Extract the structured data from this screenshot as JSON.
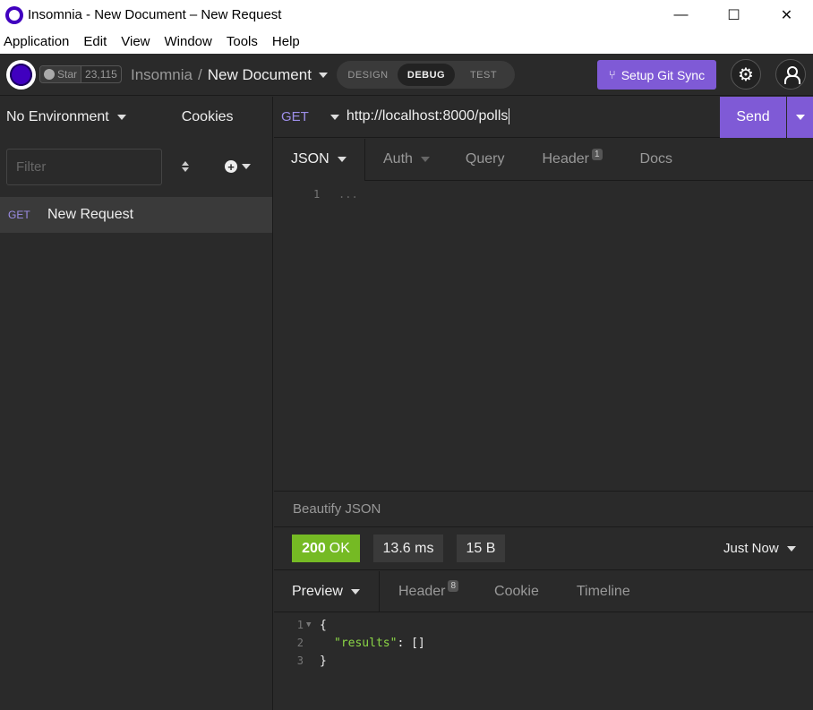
{
  "window": {
    "title": "Insomnia - New Document – New Request",
    "minimize": "—",
    "maximize": "☐",
    "close": "✕"
  },
  "menu": [
    "Application",
    "Edit",
    "View",
    "Window",
    "Tools",
    "Help"
  ],
  "header": {
    "github_star_label": "Star",
    "github_star_count": "23,115",
    "breadcrumb_root": "Insomnia",
    "breadcrumb_sep": "/",
    "breadcrumb_current": "New Document",
    "modes": [
      "DESIGN",
      "DEBUG",
      "TEST"
    ],
    "active_mode": "DEBUG",
    "git_sync_label": "Setup Git Sync"
  },
  "sidebar": {
    "environment": "No Environment",
    "cookies": "Cookies",
    "filter_placeholder": "Filter",
    "requests": [
      {
        "method": "GET",
        "name": "New Request"
      }
    ]
  },
  "request": {
    "method": "GET",
    "url": "http://localhost:8000/polls",
    "send_label": "Send",
    "tabs": [
      {
        "label": "JSON",
        "active": true
      },
      {
        "label": "Auth"
      },
      {
        "label": "Query"
      },
      {
        "label": "Header",
        "badge": "1"
      },
      {
        "label": "Docs"
      }
    ],
    "editor": {
      "line": "1",
      "placeholder": "..."
    },
    "beautify_label": "Beautify JSON"
  },
  "response": {
    "status_code": "200",
    "status_text": "OK",
    "time": "13.6 ms",
    "size": "15 B",
    "history": "Just Now",
    "tabs": [
      {
        "label": "Preview",
        "active": true
      },
      {
        "label": "Header",
        "badge": "8"
      },
      {
        "label": "Cookie"
      },
      {
        "label": "Timeline"
      }
    ],
    "body_lines": [
      {
        "num": "1",
        "text": "{"
      },
      {
        "num": "2",
        "key": "\"results\"",
        "rest": ": []"
      },
      {
        "num": "3",
        "text": "}"
      }
    ]
  },
  "colors": {
    "accent": "#7f5ad6",
    "method_get": "#9d8ee8",
    "status_ok": "#75ba24",
    "json_string": "#8bd646"
  }
}
